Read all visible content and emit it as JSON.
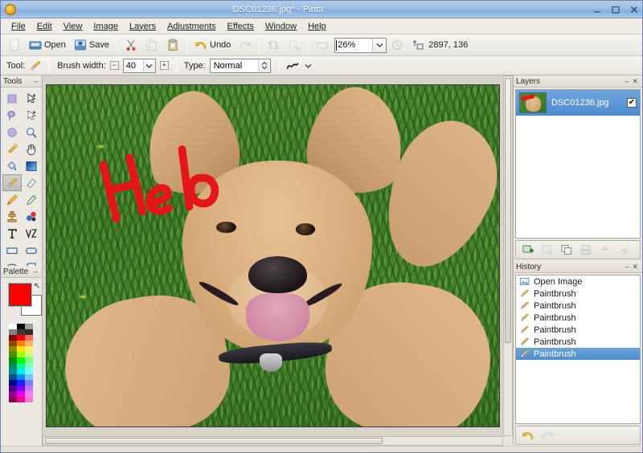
{
  "window": {
    "title": "DSC01236.jpg* - Pinta",
    "icon": "pinta-app-icon",
    "buttons": [
      {
        "name": "minimize-button",
        "glyph": "–"
      },
      {
        "name": "maximize-button",
        "glyph": "□"
      },
      {
        "name": "close-button",
        "glyph": "✕"
      }
    ]
  },
  "menubar": {
    "items": [
      {
        "label": "File"
      },
      {
        "label": "Edit"
      },
      {
        "label": "View"
      },
      {
        "label": "Image"
      },
      {
        "label": "Layers"
      },
      {
        "label": "Adjustments"
      },
      {
        "label": "Effects"
      },
      {
        "label": "Window"
      },
      {
        "label": "Help"
      }
    ]
  },
  "toolbar": {
    "new_label": "",
    "open_label": "Open",
    "save_label": "Save",
    "undo_label": "Undo",
    "redo_label": "",
    "zoom_value": "26%",
    "coordinates": "2897, 136",
    "icons": {
      "new": "new-file-icon",
      "open": "open-folder-icon",
      "save": "save-disk-icon",
      "cut": "scissors-icon",
      "copy": "copy-icon",
      "paste": "clipboard-paste-icon",
      "undo": "undo-arrow-icon",
      "redo": "redo-arrow-icon",
      "crop": "crop-selection-icon",
      "deselect": "deselect-icon",
      "zoom_fit": "zoom-to-window-icon",
      "zoom_reset": "zoom-reset-icon",
      "cursor_position": "cursor-position-icon"
    }
  },
  "tool_options": {
    "tool_label": "Tool:",
    "tool_icon": "paintbrush-icon",
    "brush_width_label": "Brush width:",
    "brush_width_value": "40",
    "decrease_glyph": "−",
    "increase_glyph": "+",
    "type_label": "Type:",
    "type_value": "Normal",
    "blend_icon": "brush-stroke-icon"
  },
  "tools_panel": {
    "title": "Tools",
    "minimize_glyph": "–",
    "selected_index": 10,
    "items": [
      {
        "name": "rectangle-select-tool"
      },
      {
        "name": "move-selected-tool"
      },
      {
        "name": "lasso-select-tool"
      },
      {
        "name": "move-selection-tool"
      },
      {
        "name": "ellipse-select-tool"
      },
      {
        "name": "zoom-tool"
      },
      {
        "name": "magic-wand-tool"
      },
      {
        "name": "pan-tool"
      },
      {
        "name": "paint-bucket-tool"
      },
      {
        "name": "gradient-tool"
      },
      {
        "name": "paintbrush-tool"
      },
      {
        "name": "eraser-tool"
      },
      {
        "name": "pencil-tool"
      },
      {
        "name": "color-picker-tool"
      },
      {
        "name": "clone-stamp-tool"
      },
      {
        "name": "recolor-tool"
      },
      {
        "name": "text-tool"
      },
      {
        "name": "line-curve-tool"
      },
      {
        "name": "rectangle-tool"
      },
      {
        "name": "rounded-rectangle-tool"
      },
      {
        "name": "ellipse-tool"
      },
      {
        "name": "freeform-shape-tool"
      }
    ]
  },
  "palette_panel": {
    "title": "Palette",
    "minimize_glyph": "–",
    "primary_color": "#ff0000",
    "secondary_color": "#ffffff",
    "swap_glyph": "↖",
    "grid_colors": [
      "#ffffff",
      "#000000",
      "#a0a0a0",
      "#808080",
      "#3a3a3a",
      "#2b2b2b",
      "#8c0000",
      "#ff0000",
      "#ff6a5e",
      "#8c4a00",
      "#ff7f00",
      "#ffb06a",
      "#8c8c00",
      "#ffe500",
      "#fff06a",
      "#4f8c00",
      "#a6ff00",
      "#d2ff7a",
      "#008c00",
      "#00ff00",
      "#7aff7a",
      "#008c4f",
      "#00ff8c",
      "#7affc0",
      "#008c8c",
      "#00f0f0",
      "#7affff",
      "#004f8c",
      "#0090ff",
      "#7ac4ff",
      "#00008c",
      "#2020ff",
      "#8080ff",
      "#4f008c",
      "#8000ff",
      "#b87aff",
      "#8c008c",
      "#f000f0",
      "#ff7aff",
      "#8c004f",
      "#ff0090",
      "#ff7ac4"
    ]
  },
  "canvas": {
    "image_name": "DSC01236.jpg",
    "drawn_text": "Helo",
    "drawn_text_color": "#e51616",
    "scroll_h_name": "horizontal-scrollbar",
    "scroll_v_name": "vertical-scrollbar"
  },
  "layers_panel": {
    "title": "Layers",
    "minimize_glyph": "–",
    "close_glyph": "✕",
    "rows": [
      {
        "name": "DSC01236.jpg",
        "visible": true,
        "check_glyph": "✔"
      }
    ],
    "toolbar_buttons": [
      {
        "name": "add-layer-button",
        "enabled": true
      },
      {
        "name": "delete-layer-button",
        "enabled": false
      },
      {
        "name": "duplicate-layer-button",
        "enabled": true
      },
      {
        "name": "merge-layer-down-button",
        "enabled": false
      },
      {
        "name": "move-layer-up-button",
        "enabled": false
      },
      {
        "name": "move-layer-down-button",
        "enabled": false
      }
    ]
  },
  "history_panel": {
    "title": "History",
    "minimize_glyph": "–",
    "close_glyph": "✕",
    "rows": [
      {
        "label": "Open Image",
        "icon": "open-image-icon",
        "selected": false
      },
      {
        "label": "Paintbrush",
        "icon": "paintbrush-icon",
        "selected": false
      },
      {
        "label": "Paintbrush",
        "icon": "paintbrush-icon",
        "selected": false
      },
      {
        "label": "Paintbrush",
        "icon": "paintbrush-icon",
        "selected": false
      },
      {
        "label": "Paintbrush",
        "icon": "paintbrush-icon",
        "selected": false
      },
      {
        "label": "Paintbrush",
        "icon": "paintbrush-icon",
        "selected": false
      },
      {
        "label": "Paintbrush",
        "icon": "paintbrush-icon",
        "selected": true
      }
    ],
    "toolbar_buttons": [
      {
        "name": "history-undo-button",
        "enabled": true
      },
      {
        "name": "history-redo-button",
        "enabled": false
      }
    ]
  }
}
